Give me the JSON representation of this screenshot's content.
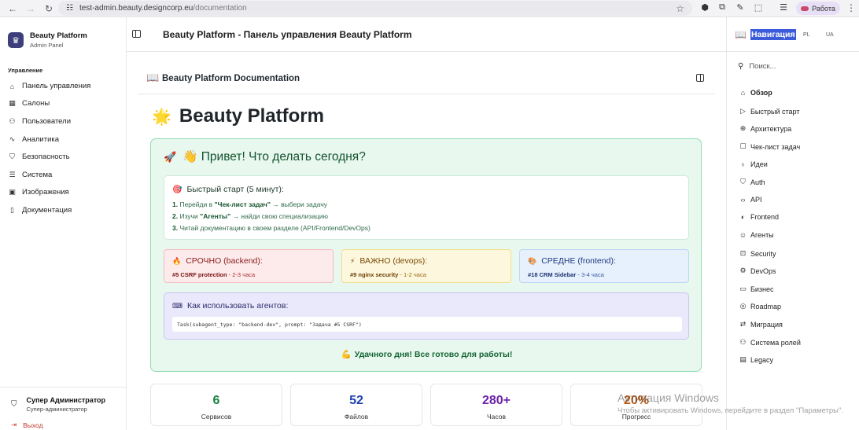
{
  "browser": {
    "url_host": "test-admin.beauty.designcorp.eu",
    "url_path": "/documentation",
    "profile_label": "Работа"
  },
  "sidebar": {
    "brand_title": "Beauty Platform",
    "brand_subtitle": "Admin Panel",
    "group_label": "Управление",
    "items": [
      {
        "label": "Панель управления",
        "icon": "home-icon"
      },
      {
        "label": "Салоны",
        "icon": "building-icon"
      },
      {
        "label": "Пользователи",
        "icon": "users-icon"
      },
      {
        "label": "Аналитика",
        "icon": "chart-icon"
      },
      {
        "label": "Безопасность",
        "icon": "shield-icon"
      },
      {
        "label": "Система",
        "icon": "database-icon"
      },
      {
        "label": "Изображения",
        "icon": "image-icon"
      },
      {
        "label": "Документация",
        "icon": "book-icon"
      }
    ],
    "user_name": "Супер Администратор",
    "user_role": "Супер-администратор",
    "logout_label": "Выход"
  },
  "header": {
    "title": "Beauty Platform - Панель управления Beauty Platform"
  },
  "doc": {
    "header_title": "Beauty Platform Documentation",
    "h1": "Beauty Platform",
    "welcome_title": "👋 Привет! Что делать сегодня?",
    "quick_title": "Быстрый старт (5 минут):",
    "steps": [
      {
        "num": "1.",
        "pre": "Перейди в ",
        "bold": "\"Чек-лист задач\"",
        "post": " → выбери задачу"
      },
      {
        "num": "2.",
        "pre": "Изучи ",
        "bold": "\"Агенты\"",
        "post": " → найди свою специализацию"
      },
      {
        "num": "3.",
        "pre": "Читай документацию в своем разделе (API/Frontend/DevOps)",
        "bold": "",
        "post": ""
      }
    ],
    "priorities": [
      {
        "title": "СРОЧНО (backend):",
        "task": "#5 CSRF protection",
        "time": " - 2-3 часа"
      },
      {
        "title": "ВАЖНО (devops):",
        "task": "#9 nginx security",
        "time": " - 1-2 часа"
      },
      {
        "title": "СРЕДНЕ (frontend):",
        "task": "#18 CRM Sidebar",
        "time": " - 3-4 часа"
      }
    ],
    "agents_title": "Как использовать агентов:",
    "agents_code": "Task(subagent_type: \"backend-dev\", prompt: \"Задача #5 CSRF\")",
    "good_day": "Удачного дня! Все готово для работы!"
  },
  "stats": [
    {
      "value": "6",
      "label": "Сервисов",
      "color": "#15803d"
    },
    {
      "value": "52",
      "label": "Файлов",
      "color": "#1e40af"
    },
    {
      "value": "280+",
      "label": "Часов",
      "color": "#6b21a8"
    },
    {
      "value": "20%",
      "label": "Прогресс",
      "color": "#b45309"
    }
  ],
  "right_panel": {
    "title": "Навигация",
    "lang_pl": "PL",
    "lang_ua": "UA",
    "search_placeholder": "Поиск...",
    "items": [
      {
        "label": "Обзор",
        "icon": "home-icon"
      },
      {
        "label": "Быстрый старт",
        "icon": "play-icon"
      },
      {
        "label": "Архитектура",
        "icon": "globe-icon"
      },
      {
        "label": "Чек-лист задач",
        "icon": "clipboard-icon"
      },
      {
        "label": "Идеи",
        "icon": "lightbulb-icon"
      },
      {
        "label": "Auth",
        "icon": "shield-icon"
      },
      {
        "label": "API",
        "icon": "code-icon"
      },
      {
        "label": "Frontend",
        "icon": "palette-icon"
      },
      {
        "label": "Агенты",
        "icon": "user-icon"
      },
      {
        "label": "Security",
        "icon": "lock-icon"
      },
      {
        "label": "DevOps",
        "icon": "gear-icon"
      },
      {
        "label": "Бизнес",
        "icon": "briefcase-icon"
      },
      {
        "label": "Roadmap",
        "icon": "target-icon"
      },
      {
        "label": "Миграция",
        "icon": "migration-icon"
      },
      {
        "label": "Система ролей",
        "icon": "roles-icon"
      },
      {
        "label": "Legacy",
        "icon": "archive-icon"
      }
    ]
  },
  "watermark": {
    "line1": "Активация Windows",
    "line2": "Чтобы активировать Windows, перейдите в раздел \"Параметры\"."
  }
}
